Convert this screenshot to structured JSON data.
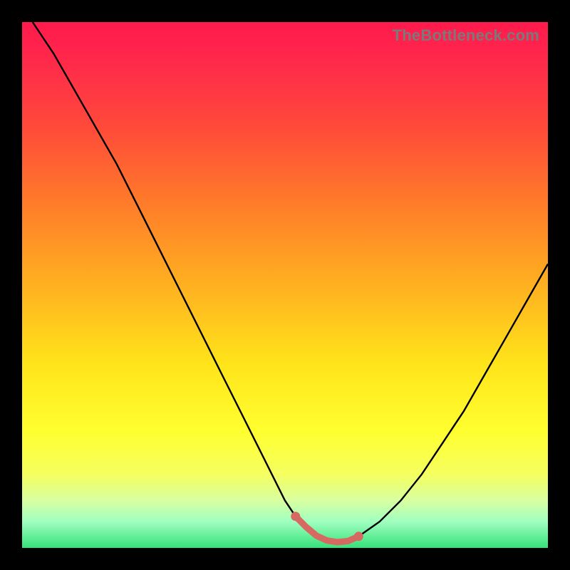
{
  "watermark": "TheBottleneck.com",
  "colors": {
    "background": "#000000",
    "curve": "#000000",
    "marker": "#d66a62",
    "gradient_top": "#ff1a4d",
    "gradient_bottom": "#35e27a"
  },
  "chart_data": {
    "type": "line",
    "title": "",
    "xlabel": "",
    "ylabel": "",
    "xlim": [
      0,
      100
    ],
    "ylim": [
      0,
      100
    ],
    "series": [
      {
        "name": "curve",
        "x": [
          2,
          6,
          10,
          14,
          18,
          22,
          26,
          30,
          34,
          38,
          42,
          46,
          50,
          52,
          54,
          56,
          58,
          60,
          62,
          64,
          68,
          72,
          76,
          80,
          84,
          88,
          92,
          96,
          100
        ],
        "values": [
          100,
          94,
          87,
          80,
          73,
          65,
          57,
          49,
          41,
          33,
          25,
          17,
          9,
          6,
          4,
          2.3,
          1.4,
          1.1,
          1.3,
          2.2,
          5,
          9,
          14,
          20,
          26,
          33,
          40,
          47,
          54
        ]
      },
      {
        "name": "flat_region_markers",
        "x": [
          52,
          54,
          56,
          58,
          60,
          62,
          64
        ],
        "values": [
          6,
          4,
          2.3,
          1.4,
          1.1,
          1.3,
          2.2
        ]
      }
    ],
    "annotations": []
  }
}
